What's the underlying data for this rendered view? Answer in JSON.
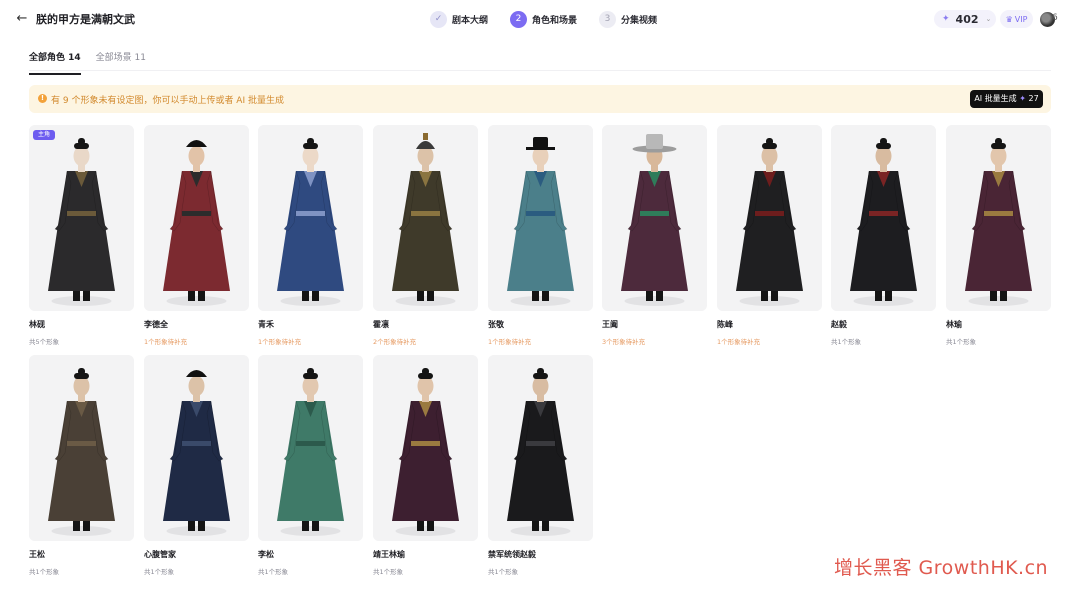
{
  "header": {
    "back_icon": "arrow-left-icon",
    "title": "朕的甲方是满朝文武",
    "steps": [
      {
        "index": "✓",
        "label": "剧本大纲",
        "state": "done"
      },
      {
        "index": "2",
        "label": "角色和场景",
        "state": "active"
      },
      {
        "index": "3",
        "label": "分集视频",
        "state": "todo"
      }
    ],
    "credits": "402",
    "vip_label": "VIP",
    "avatar_tail": "6"
  },
  "tabs": [
    {
      "label": "全部角色 14",
      "active": true
    },
    {
      "label": "全部场景 11",
      "active": false
    }
  ],
  "notice": {
    "text": "有 9 个形象未有设定图，你可以手动上传或者 AI 批量生成",
    "button_label": "AI 批量生成",
    "button_cost": "27"
  },
  "characters": [
    {
      "name": "林砚",
      "sub": "共5个形象",
      "warn": false,
      "badge": "主角",
      "robe": "#2b2a2c",
      "accent": "#6b5a3a",
      "skin": "#e9d8c8",
      "hat": "bun"
    },
    {
      "name": "李德全",
      "sub": "1个形象待补充",
      "warn": true,
      "badge": "",
      "robe": "#7c2a30",
      "accent": "#2c2c2c",
      "skin": "#e2c3a8",
      "hat": "cap"
    },
    {
      "name": "青禾",
      "sub": "1个形象待补充",
      "warn": true,
      "badge": "",
      "robe": "#2f4a80",
      "accent": "#7f93c3",
      "skin": "#ecd9c8",
      "hat": "bun"
    },
    {
      "name": "霍凛",
      "sub": "2个形象待补充",
      "warn": true,
      "badge": "",
      "robe": "#3f3a2a",
      "accent": "#8a7440",
      "skin": "#dcc2a8",
      "hat": "helm"
    },
    {
      "name": "张敬",
      "sub": "1个形象待补充",
      "warn": true,
      "badge": "",
      "robe": "#4b7f8a",
      "accent": "#2b5c80",
      "skin": "#e8d0ba",
      "hat": "wide"
    },
    {
      "name": "王阖",
      "sub": "3个形象待补充",
      "warn": true,
      "badge": "",
      "robe": "#4d2a3c",
      "accent": "#2f7c5a",
      "skin": "#d8b89a",
      "hat": "straw"
    },
    {
      "name": "陈峰",
      "sub": "1个形象待补充",
      "warn": true,
      "badge": "",
      "robe": "#1f1f21",
      "accent": "#6d1d1d",
      "skin": "#dcc0a6",
      "hat": "bun"
    },
    {
      "name": "赵毅",
      "sub": "共1个形象",
      "warn": false,
      "badge": "",
      "robe": "#1d1d20",
      "accent": "#7a2424",
      "skin": "#d8bba0",
      "hat": "bun"
    },
    {
      "name": "林瑜",
      "sub": "共1个形象",
      "warn": false,
      "badge": "",
      "robe": "#4a2535",
      "accent": "#9a7a40",
      "skin": "#e2c6ac",
      "hat": "bun"
    },
    {
      "name": "王松",
      "sub": "共1个形象",
      "warn": false,
      "badge": "",
      "robe": "#4a4036",
      "accent": "#6a5a45",
      "skin": "#dcc2a8",
      "hat": "bun"
    },
    {
      "name": "心腹管家",
      "sub": "共1个形象",
      "warn": false,
      "badge": "",
      "robe": "#1f2a45",
      "accent": "#3a4a6a",
      "skin": "#dcc2a8",
      "hat": "cap"
    },
    {
      "name": "李松",
      "sub": "共1个形象",
      "warn": false,
      "badge": "",
      "robe": "#3f7a68",
      "accent": "#2c5a4c",
      "skin": "#e2c8b0",
      "hat": "bun"
    },
    {
      "name": "靖王林瑜",
      "sub": "共1个形象",
      "warn": false,
      "badge": "",
      "robe": "#3d1f30",
      "accent": "#9a7a40",
      "skin": "#e0c4aa",
      "hat": "bun"
    },
    {
      "name": "禁军统领赵毅",
      "sub": "共1个形象",
      "warn": false,
      "badge": "",
      "robe": "#1a1a1c",
      "accent": "#3a3a3e",
      "skin": "#d8bca2",
      "hat": "bun"
    }
  ],
  "watermark": "增长黑客 GrowthHK.cn"
}
